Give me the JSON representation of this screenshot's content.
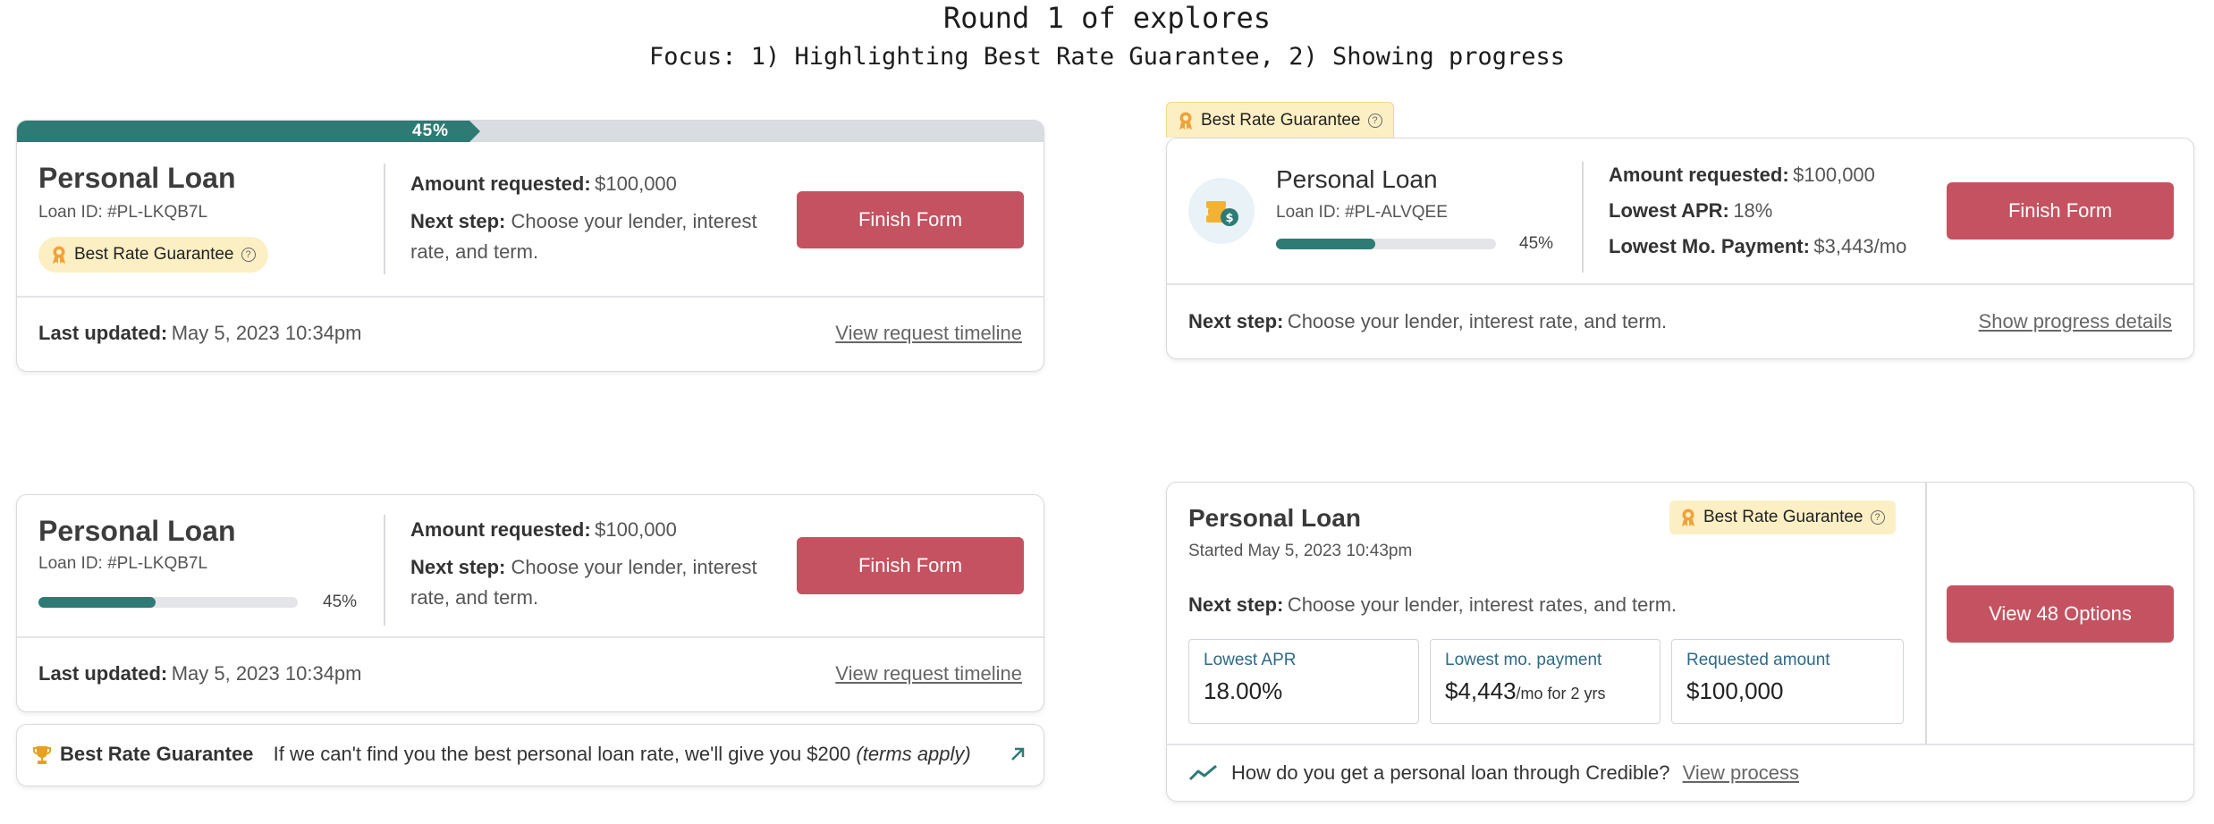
{
  "header": {
    "title": "Round 1 of explores",
    "subtitle": "Focus: 1) Highlighting Best Rate Guarantee, 2) Showing progress"
  },
  "colors": {
    "accent_button": "#c45260",
    "progress_fill": "#2e7a75",
    "badge_bg": "#fdefc4",
    "stat_label": "#2e6a86"
  },
  "card1": {
    "progress_fraction": 0.45,
    "progress_label": "45%",
    "title": "Personal Loan",
    "loan_id": "Loan ID: #PL-LKQB7L",
    "badge": "Best Rate Guarantee",
    "amount_label": "Amount requested:",
    "amount_value": "$100,000",
    "next_step_label": "Next step:",
    "next_step_line1": "Choose your lender, interest",
    "next_step_line2": "rate, and term.",
    "button": "Finish Form",
    "updated_label": "Last updated:",
    "updated_value": "May 5, 2023 10:34pm",
    "link": "View request timeline"
  },
  "card2": {
    "badge": "Best Rate Guarantee",
    "title": "Personal Loan",
    "loan_id": "Loan ID: #PL-ALVQEE",
    "progress_fraction": 0.45,
    "progress_label": "45%",
    "icon": "money-coins-icon",
    "amount_label": "Amount requested:",
    "amount_value": "$100,000",
    "apr_label": "Lowest APR:",
    "apr_value": "18%",
    "payment_label": "Lowest Mo. Payment:",
    "payment_value": "$3,443/mo",
    "button": "Finish Form",
    "next_step_label": "Next step:",
    "next_step_value": "Choose your lender, interest rate, and term.",
    "link": "Show progress details"
  },
  "card3": {
    "title": "Personal Loan",
    "loan_id": "Loan ID: #PL-LKQB7L",
    "progress_fraction": 0.45,
    "progress_label": "45%",
    "amount_label": "Amount requested:",
    "amount_value": "$100,000",
    "next_step_label": "Next step:",
    "next_step_line1": "Choose your lender, interest",
    "next_step_line2": "rate, and term.",
    "button": "Finish Form",
    "updated_label": "Last updated:",
    "updated_value": "May 5, 2023 10:34pm",
    "link": "View request timeline"
  },
  "banner3": {
    "title": "Best Rate Guarantee",
    "text": "If we can't find you the best personal loan rate, we'll give you $200",
    "terms": "(terms apply)",
    "icon": "external-arrow-icon"
  },
  "card4": {
    "title": "Personal Loan",
    "started": "Started May 5, 2023 10:43pm",
    "badge": "Best Rate Guarantee",
    "next_step_label": "Next step:",
    "next_step_value": "Choose your lender, interest rates, and term.",
    "stats": [
      {
        "label": "Lowest APR",
        "value": "18.00%",
        "suffix": ""
      },
      {
        "label": "Lowest mo. payment",
        "value": "$4,443",
        "suffix": "/mo for 2 yrs"
      },
      {
        "label": "Requested amount",
        "value": "$100,000",
        "suffix": ""
      }
    ],
    "button": "View 48 Options",
    "footer_text": "How do you get a personal loan through Credible?",
    "footer_link": "View process"
  }
}
